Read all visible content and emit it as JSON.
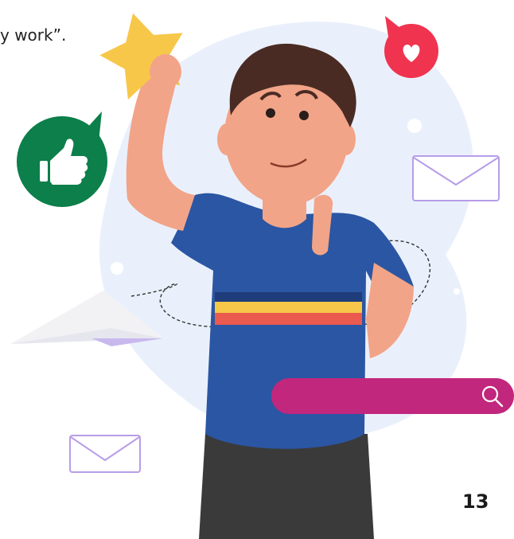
{
  "caption": {
    "quote_fragment": "y work”."
  },
  "page": {
    "number": "13"
  },
  "colors": {
    "blob_background": "#eaf0fb",
    "thumbs_badge": "#0d7f4a",
    "heart_badge": "#f0334f",
    "search_bar": "#c0277d",
    "star": "#f7c74a",
    "shirt": "#2b56a3",
    "envelope_outline": "#b79de8"
  },
  "icons": {
    "thumbs": "thumbs-up-icon",
    "heart": "heart-icon",
    "star": "star-icon",
    "envelope": "envelope-icon",
    "plane": "paper-plane-icon",
    "search": "search-icon"
  }
}
